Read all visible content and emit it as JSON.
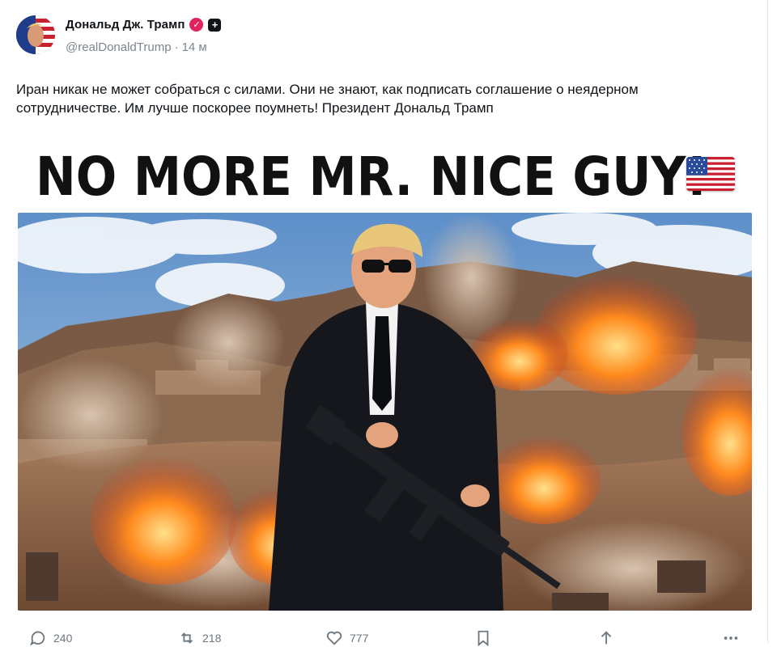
{
  "post": {
    "display_name": "Дональд Дж. Трамп",
    "handle": "@realDonaldTrump",
    "separator": "·",
    "time": "14 м",
    "text": "Иран никак не может собраться с силами. Они не знают, как подписать соглашение о неядерном сотрудничестве. Им лучше поскорее поумнеть! Президент Дональд Трамп",
    "badges": [
      "verified-icon",
      "plus-badge-icon"
    ]
  },
  "media": {
    "banner_text": "NO MORE MR. NICE GUY!",
    "flag_icon": "us-flag-icon"
  },
  "actions": {
    "replies": "240",
    "reposts": "218",
    "likes": "777",
    "bookmark_icon": "bookmark-icon",
    "share_icon": "share-icon",
    "more_icon": "more-icon"
  },
  "colors": {
    "verified": "#e0245e",
    "text": "#0f1419",
    "muted": "#7b8690"
  }
}
